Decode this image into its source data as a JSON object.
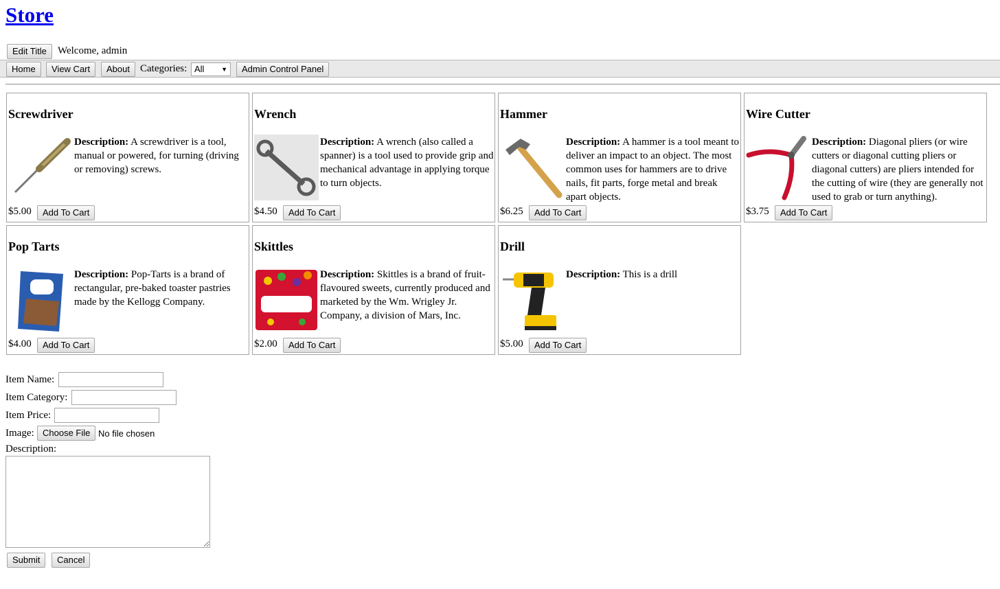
{
  "header": {
    "title": "Store",
    "edit_title_label": "Edit Title",
    "welcome": "Welcome, admin"
  },
  "nav": {
    "home": "Home",
    "view_cart": "View Cart",
    "about": "About",
    "categories_label": "Categories:",
    "categories_selected": "All",
    "admin_panel": "Admin Control Panel"
  },
  "products": [
    {
      "name": "Screwdriver",
      "desc_label": "Description:",
      "description": " A screwdriver is a tool, manual or powered, for turning (driving or removing) screws.",
      "price": "$5.00",
      "add_label": "Add To Cart",
      "image": "screwdriver-image"
    },
    {
      "name": "Wrench",
      "desc_label": "Description:",
      "description": " A wrench (also called a spanner) is a tool used to provide grip and mechanical advantage in applying torque to turn objects.",
      "price": "$4.50",
      "add_label": "Add To Cart",
      "image": "wrench-image"
    },
    {
      "name": "Hammer",
      "desc_label": "Description:",
      "description": " A hammer is a tool meant to deliver an impact to an object. The most common uses for hammers are to drive nails, fit parts, forge metal and break apart objects.",
      "price": "$6.25",
      "add_label": "Add To Cart",
      "image": "hammer-image"
    },
    {
      "name": "Wire Cutter",
      "desc_label": "Description:",
      "description": " Diagonal pliers (or wire cutters or diagonal cutting pliers or diagonal cutters) are pliers intended for the cutting of wire (they are generally not used to grab or turn anything).",
      "price": "$3.75",
      "add_label": "Add To Cart",
      "image": "wire-cutter-image"
    },
    {
      "name": "Pop Tarts",
      "desc_label": "Description:",
      "description": " Pop-Tarts is a brand of rectangular, pre-baked toaster pastries made by the Kellogg Company.",
      "price": "$4.00",
      "add_label": "Add To Cart",
      "image": "pop-tarts-image"
    },
    {
      "name": "Skittles",
      "desc_label": "Description:",
      "description": " Skittles is a brand of fruit-flavoured sweets, currently produced and marketed by the Wm. Wrigley Jr. Company, a division of Mars, Inc.",
      "price": "$2.00",
      "add_label": "Add To Cart",
      "image": "skittles-image"
    },
    {
      "name": "Drill",
      "desc_label": "Description:",
      "description": " This is a drill",
      "price": "$5.00",
      "add_label": "Add To Cart",
      "image": "drill-image"
    }
  ],
  "form": {
    "item_name_label": "Item Name:",
    "item_category_label": "Item Category:",
    "item_price_label": "Item Price:",
    "image_label": "Image:",
    "choose_file": "Choose File",
    "no_file": "No file chosen",
    "description_label": "Description:",
    "submit": "Submit",
    "cancel": "Cancel"
  }
}
